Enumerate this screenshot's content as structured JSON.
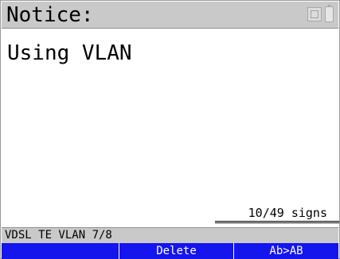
{
  "header": {
    "title": "Notice:",
    "icons": [
      "network-icon",
      "battery-icon"
    ]
  },
  "editor": {
    "text": "Using VLAN",
    "counter": "10/49 signs"
  },
  "path": {
    "text": "VDSL TE VLAN 7/8"
  },
  "softkeys": [
    {
      "label": ""
    },
    {
      "label": "Delete"
    },
    {
      "label": "Ab>AB"
    }
  ],
  "colors": {
    "title_bar": "#c9c9c9",
    "softkey_bar": "#1515ee",
    "softkey_text": "#ffffff",
    "background": "#ffffff"
  }
}
